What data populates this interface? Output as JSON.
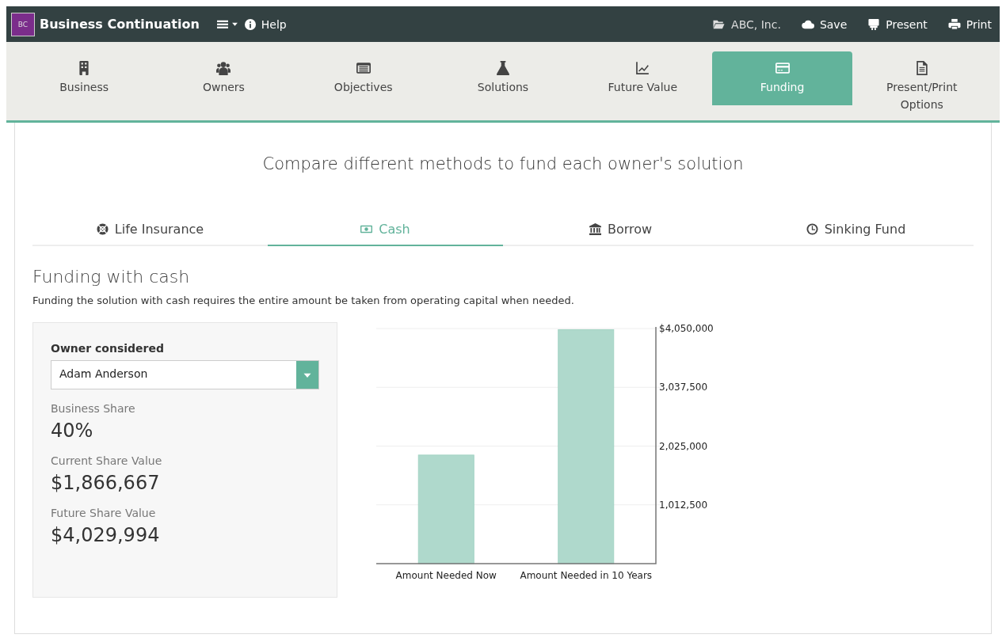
{
  "top_bar": {
    "logo": "BC",
    "title": "Business Continuation",
    "help": "Help",
    "client": "ABC, Inc.",
    "actions": [
      "Save",
      "Present",
      "Print"
    ]
  },
  "nav_tabs": [
    {
      "label": "Business",
      "selected": false
    },
    {
      "label": "Owners",
      "selected": false
    },
    {
      "label": "Objectives",
      "selected": false
    },
    {
      "label": "Solutions",
      "selected": false
    },
    {
      "label": "Future Value",
      "selected": false
    },
    {
      "label": "Funding",
      "selected": true
    },
    {
      "label": "Present/Print Options",
      "selected": false
    }
  ],
  "heading": "Compare different methods to fund each owner's solution",
  "method_tabs": [
    {
      "label": "Life Insurance",
      "selected": false
    },
    {
      "label": "Cash",
      "selected": true
    },
    {
      "label": "Borrow",
      "selected": false
    },
    {
      "label": "Sinking Fund",
      "selected": false
    }
  ],
  "section": {
    "title": "Funding with cash",
    "description": "Funding the solution with cash requires the entire amount be taken from operating capital when needed."
  },
  "owner_panel": {
    "label": "Owner considered",
    "owner": "Adam Anderson",
    "stats": [
      {
        "label": "Business Share",
        "value": "40%"
      },
      {
        "label": "Current Share Value",
        "value": "$1,866,667"
      },
      {
        "label": "Future Share Value",
        "value": "$4,029,994"
      }
    ]
  },
  "chart_data": {
    "type": "bar",
    "categories": [
      "Amount Needed Now",
      "Amount Needed in 10 Years"
    ],
    "grid": true,
    "series": [
      {
        "color": "#afd9cc",
        "values": [
          1870000,
          4030000
        ]
      }
    ],
    "ylim": [
      0,
      4050000
    ],
    "yticks": [
      {
        "value": 1012500,
        "label": "1,012,500"
      },
      {
        "value": 2025000,
        "label": "2,025,000"
      },
      {
        "value": 3037500,
        "label": "3,037,500"
      },
      {
        "value": 4050000,
        "label": "$4,050,000"
      }
    ]
  }
}
